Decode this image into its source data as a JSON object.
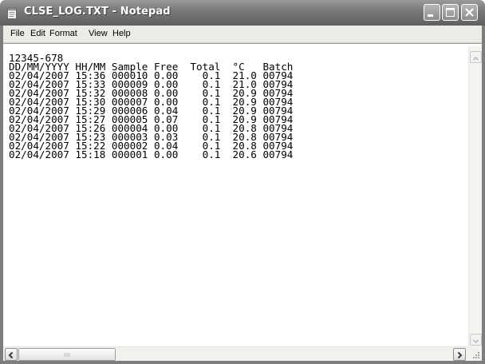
{
  "window": {
    "title": "CLSE_LOG.TXT - Notepad"
  },
  "menu": {
    "items": [
      "File",
      "Edit",
      "Format",
      "View",
      "Help"
    ]
  },
  "document": {
    "lines": [
      "12345-678",
      "DD/MM/YYYY HH/MM Sample Free  Total  °C   Batch",
      "02/04/2007 15:36 000010 0.00    0.1  21.0 00794",
      "02/04/2007 15:33 000009 0.00    0.1  21.0 00794",
      "02/04/2007 15:32 000008 0.00    0.1  20.9 00794",
      "02/04/2007 15:30 000007 0.00    0.1  20.9 00794",
      "02/04/2007 15:29 000006 0.04    0.1  20.9 00794",
      "02/04/2007 15:27 000005 0.07    0.1  20.9 00794",
      "02/04/2007 15:26 000004 0.00    0.1  20.8 00794",
      "02/04/2007 15:23 000003 0.03    0.1  20.8 00794",
      "02/04/2007 15:22 000002 0.04    0.1  20.8 00794",
      "02/04/2007 15:18 000001 0.00    0.1  20.6 00794"
    ]
  },
  "icons": {
    "app": "notepad-icon",
    "minimize": "minimize-icon",
    "maximize": "maximize-icon",
    "close": "close-icon"
  },
  "colors": {
    "titlebar": "#7a7a7a",
    "title_text": "#ffffff",
    "menubar": "#ecebe6",
    "editor_bg": "#ffffff",
    "text": "#000000"
  }
}
